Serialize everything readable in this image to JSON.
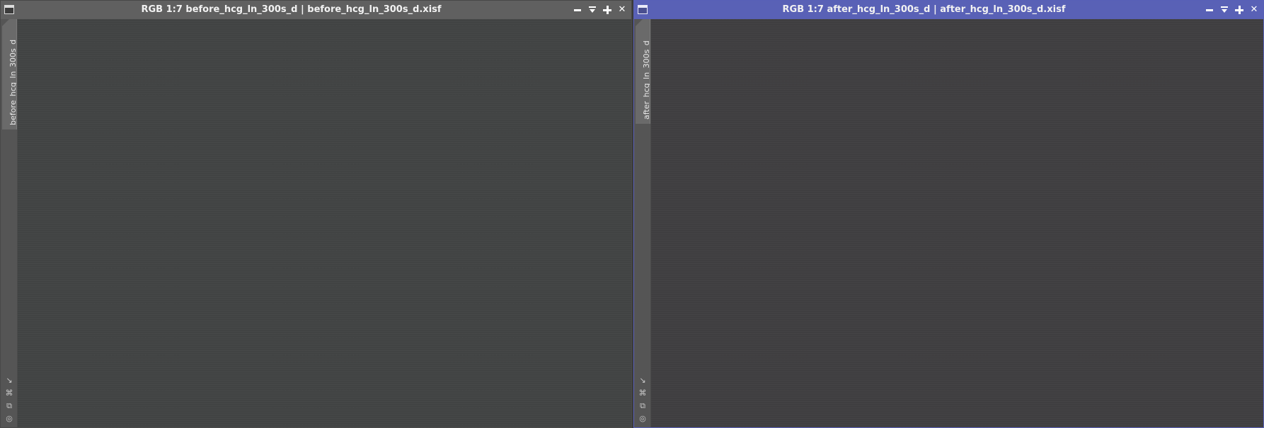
{
  "windows": {
    "left": {
      "title": "RGB 1:7 before_hcg_ln_300s_d | before_hcg_ln_300s_d.xisf",
      "tab_label": "before_hcg_ln_300s_d",
      "active": false
    },
    "right": {
      "title": "RGB 1:7 after_hcg_ln_300s_d | after_hcg_ln_300s_d.xisf",
      "tab_label": "after_hcg_ln_300s_d",
      "active": true
    }
  },
  "controls": {
    "minimize": "minimize-icon",
    "shade": "shade-icon",
    "maximize": "maximize-icon",
    "close": "close-icon",
    "close_glyph": "✕"
  },
  "side_icons": {
    "zoom_fit": "↘",
    "fit_window": "⌘",
    "clone": "⧉",
    "target": "◎"
  },
  "colors": {
    "active_titlebar": "#5961b6",
    "inactive_titlebar": "#606060",
    "image_background": "#404040"
  }
}
